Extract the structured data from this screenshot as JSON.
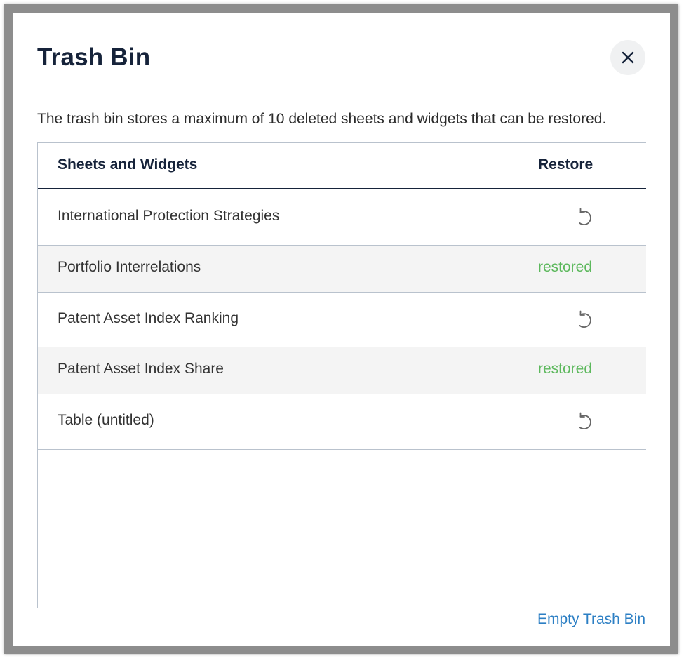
{
  "dialog": {
    "title": "Trash Bin",
    "close_icon": "close-icon",
    "description": "The trash bin stores a maximum of 10 deleted sheets and widgets that can be restored."
  },
  "table": {
    "headers": {
      "name": "Sheets and Widgets",
      "restore": "Restore"
    },
    "rows": [
      {
        "label": "International Protection Strategies",
        "status": "restorable",
        "icon": "restore-icon"
      },
      {
        "label": "Portfolio Interrelations",
        "status": "restored",
        "status_text": "restored"
      },
      {
        "label": "Patent Asset Index Ranking",
        "status": "restorable",
        "icon": "restore-icon"
      },
      {
        "label": "Patent Asset Index Share",
        "status": "restored",
        "status_text": "restored"
      },
      {
        "label": "Table (untitled)",
        "status": "restorable",
        "icon": "restore-icon"
      }
    ]
  },
  "footer": {
    "empty_label": "Empty Trash Bin"
  },
  "colors": {
    "title": "#16233a",
    "restored": "#5cb85c",
    "link": "#2c7fc4",
    "row_alt": "#f4f4f4",
    "border": "#b9c2cd"
  }
}
